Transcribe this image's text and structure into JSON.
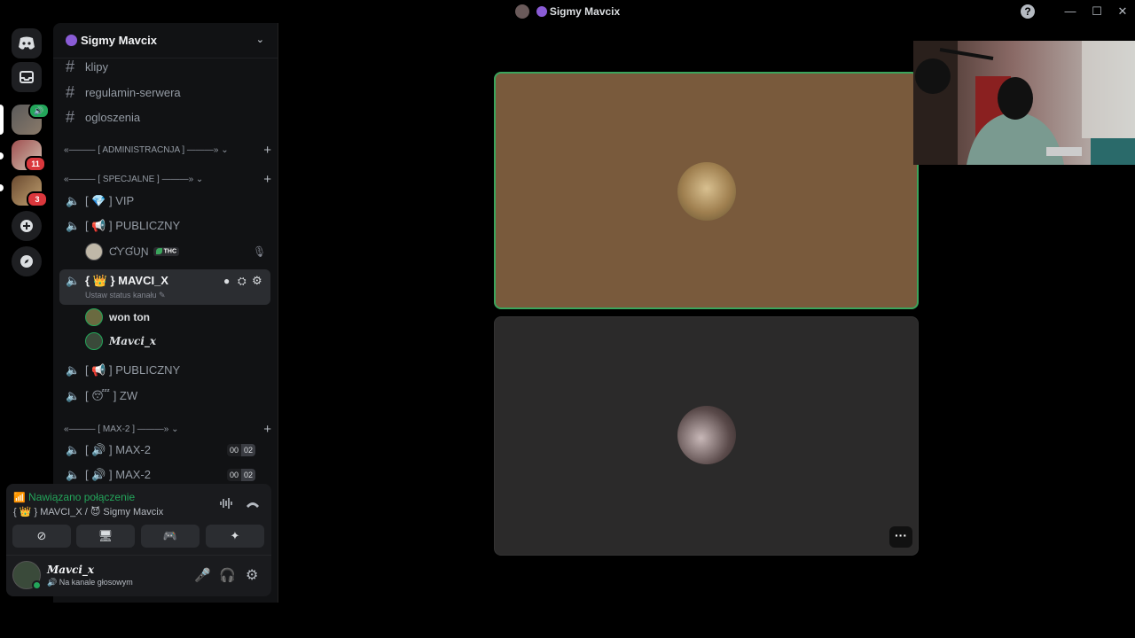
{
  "window": {
    "title": "Sigmy Mavcix",
    "help": "?",
    "minimize": "—",
    "maximize": "☐",
    "close": "✕"
  },
  "server": {
    "name": "Sigmy Mavcix"
  },
  "rail": {
    "badges": {
      "speaker": "🔊",
      "server2": "11",
      "server3": "3"
    }
  },
  "channels": {
    "text": [
      {
        "name": "klipy"
      },
      {
        "name": "regulamin-serwera"
      },
      {
        "name": "ogloszenia"
      }
    ],
    "cat_admin": "«——— [ ADMINISTRACNJA ] ———» ⌄",
    "cat_special": "«——— [ SPECJALNE ] ———» ⌄",
    "vip": "[ 💎 ] VIP",
    "publiczny1": "[ 📢 ] PUBLICZNY",
    "user_cygun": "ƇƳƓƲƝ",
    "user_cygun_tag": "THC",
    "mavci_channel": "{ 👑 } MAVCI_X",
    "mavci_status": "Ustaw status kanału ✎",
    "user_wonton": "won ton",
    "user_mavci": "Mavci_x",
    "publiczny2": "[ 📢 ] PUBLICZNY",
    "zw": "[ 😴 ] ZW",
    "cat_max": "«——— [ MAX-2 ] ———» ⌄",
    "max2_a": "[ 🔊 ] MAX-2",
    "max2_b": "[ 🔊 ] MAX-2",
    "count_a": [
      "00",
      "02"
    ],
    "count_b": [
      "00",
      "02"
    ]
  },
  "voice": {
    "status": "Nawiązano połączenie",
    "location": "{ 👑 } MAVCI_X / 😈 Sigmy Mavcix"
  },
  "me": {
    "name": "Mavci_x",
    "status": "Na kanale głosowym"
  },
  "colors": {
    "connected": "#23a55a",
    "speaking": "#3ba55c"
  }
}
